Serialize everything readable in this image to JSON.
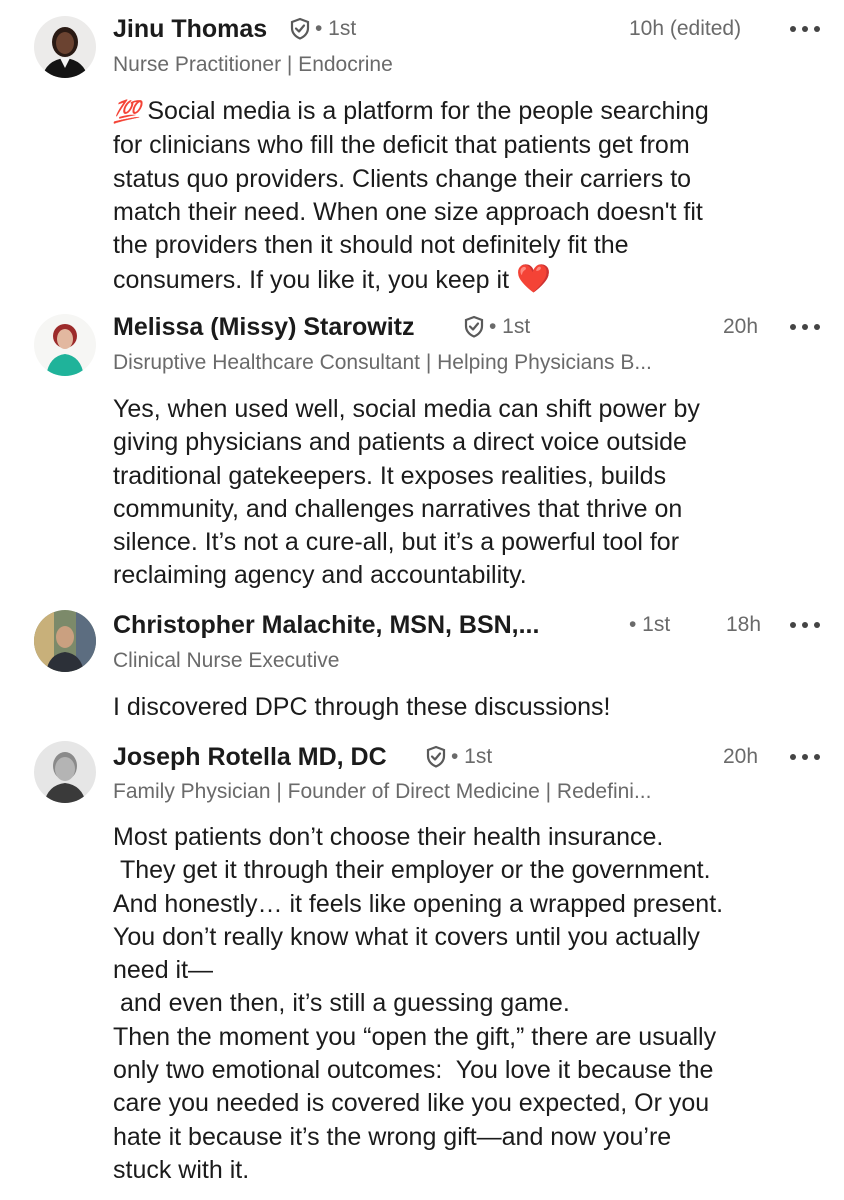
{
  "comments": [
    {
      "name": "Jinu Thomas",
      "degree": "• 1st",
      "time": "10h (edited)",
      "headline": "Nurse Practitioner | Endocrine",
      "prefix_emoji": "💯",
      "body": " Social media is a platform for the people searching\nfor clinicians who fill the deficit that patients get from\nstatus quo providers. Clients change their carriers to\nmatch their need. When one size approach doesn't fit\nthe providers then it should not definitely fit the\nconsumers. If you like it, you keep it ",
      "suffix_emoji": "❤️",
      "verified": true
    },
    {
      "name": "Melissa (Missy) Starowitz",
      "degree": "• 1st",
      "time": "20h",
      "headline": "Disruptive Healthcare Consultant | Helping Physicians B...",
      "body": "Yes, when used well, social media can shift power by\ngiving physicians and patients a direct voice outside\ntraditional gatekeepers. It exposes realities, builds\ncommunity, and challenges narratives that thrive on\nsilence. It’s not a cure-all, but it’s a powerful tool for\nreclaiming agency and accountability.",
      "verified": true
    },
    {
      "name": "Christopher Malachite, MSN, BSN,...",
      "degree": "• 1st",
      "time": "18h",
      "headline": "Clinical Nurse Executive",
      "body": "I discovered DPC through these discussions!",
      "verified": false
    },
    {
      "name": "Joseph Rotella MD, DC",
      "degree": "• 1st",
      "time": "20h",
      "headline": "Family Physician | Founder of Direct Medicine | Redefini...",
      "body": "Most patients don’t choose their health insurance.\n They get it through their employer or the government.\nAnd honestly… it feels like opening a wrapped present.\nYou don’t really know what it covers until you actually\nneed it—\n and even then, it’s still a guessing game.\nThen the moment you “open the gift,” there are usually\nonly two emotional outcomes:  You love it because the\ncare you needed is covered like you expected, Or you\nhate it because it’s the wrong gift—and now you’re\nstuck with it.",
      "verified": true
    }
  ],
  "icons": {
    "verified": "verified-shield-icon",
    "more": "more-options-icon"
  },
  "colors": {
    "text": "#1b1b1b",
    "secondary": "#6a6a6a",
    "heart": "#e0141e",
    "hundred": "#e0141e"
  }
}
